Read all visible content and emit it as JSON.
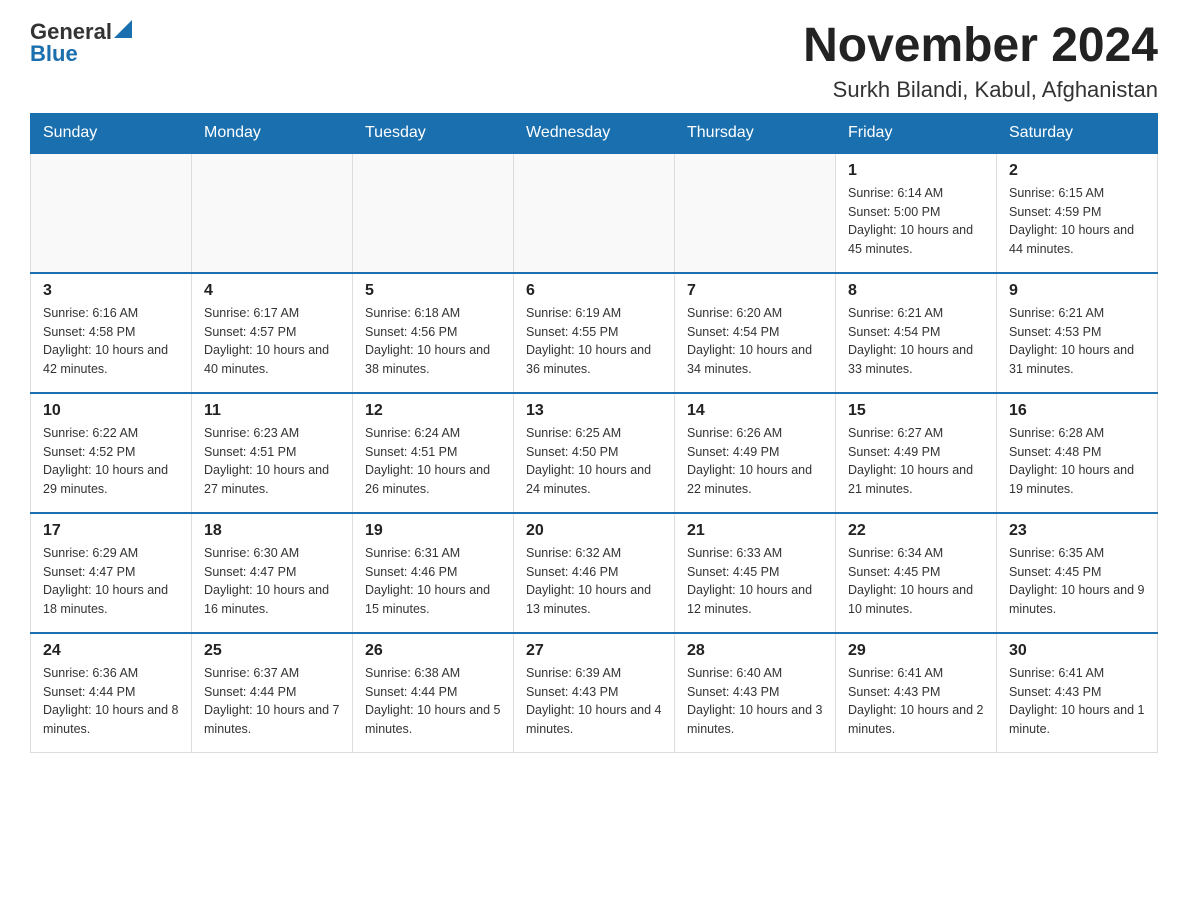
{
  "logo": {
    "general": "General",
    "blue": "Blue"
  },
  "title": "November 2024",
  "subtitle": "Surkh Bilandi, Kabul, Afghanistan",
  "days_of_week": [
    "Sunday",
    "Monday",
    "Tuesday",
    "Wednesday",
    "Thursday",
    "Friday",
    "Saturday"
  ],
  "weeks": [
    [
      {
        "day": "",
        "info": ""
      },
      {
        "day": "",
        "info": ""
      },
      {
        "day": "",
        "info": ""
      },
      {
        "day": "",
        "info": ""
      },
      {
        "day": "",
        "info": ""
      },
      {
        "day": "1",
        "info": "Sunrise: 6:14 AM\nSunset: 5:00 PM\nDaylight: 10 hours and 45 minutes."
      },
      {
        "day": "2",
        "info": "Sunrise: 6:15 AM\nSunset: 4:59 PM\nDaylight: 10 hours and 44 minutes."
      }
    ],
    [
      {
        "day": "3",
        "info": "Sunrise: 6:16 AM\nSunset: 4:58 PM\nDaylight: 10 hours and 42 minutes."
      },
      {
        "day": "4",
        "info": "Sunrise: 6:17 AM\nSunset: 4:57 PM\nDaylight: 10 hours and 40 minutes."
      },
      {
        "day": "5",
        "info": "Sunrise: 6:18 AM\nSunset: 4:56 PM\nDaylight: 10 hours and 38 minutes."
      },
      {
        "day": "6",
        "info": "Sunrise: 6:19 AM\nSunset: 4:55 PM\nDaylight: 10 hours and 36 minutes."
      },
      {
        "day": "7",
        "info": "Sunrise: 6:20 AM\nSunset: 4:54 PM\nDaylight: 10 hours and 34 minutes."
      },
      {
        "day": "8",
        "info": "Sunrise: 6:21 AM\nSunset: 4:54 PM\nDaylight: 10 hours and 33 minutes."
      },
      {
        "day": "9",
        "info": "Sunrise: 6:21 AM\nSunset: 4:53 PM\nDaylight: 10 hours and 31 minutes."
      }
    ],
    [
      {
        "day": "10",
        "info": "Sunrise: 6:22 AM\nSunset: 4:52 PM\nDaylight: 10 hours and 29 minutes."
      },
      {
        "day": "11",
        "info": "Sunrise: 6:23 AM\nSunset: 4:51 PM\nDaylight: 10 hours and 27 minutes."
      },
      {
        "day": "12",
        "info": "Sunrise: 6:24 AM\nSunset: 4:51 PM\nDaylight: 10 hours and 26 minutes."
      },
      {
        "day": "13",
        "info": "Sunrise: 6:25 AM\nSunset: 4:50 PM\nDaylight: 10 hours and 24 minutes."
      },
      {
        "day": "14",
        "info": "Sunrise: 6:26 AM\nSunset: 4:49 PM\nDaylight: 10 hours and 22 minutes."
      },
      {
        "day": "15",
        "info": "Sunrise: 6:27 AM\nSunset: 4:49 PM\nDaylight: 10 hours and 21 minutes."
      },
      {
        "day": "16",
        "info": "Sunrise: 6:28 AM\nSunset: 4:48 PM\nDaylight: 10 hours and 19 minutes."
      }
    ],
    [
      {
        "day": "17",
        "info": "Sunrise: 6:29 AM\nSunset: 4:47 PM\nDaylight: 10 hours and 18 minutes."
      },
      {
        "day": "18",
        "info": "Sunrise: 6:30 AM\nSunset: 4:47 PM\nDaylight: 10 hours and 16 minutes."
      },
      {
        "day": "19",
        "info": "Sunrise: 6:31 AM\nSunset: 4:46 PM\nDaylight: 10 hours and 15 minutes."
      },
      {
        "day": "20",
        "info": "Sunrise: 6:32 AM\nSunset: 4:46 PM\nDaylight: 10 hours and 13 minutes."
      },
      {
        "day": "21",
        "info": "Sunrise: 6:33 AM\nSunset: 4:45 PM\nDaylight: 10 hours and 12 minutes."
      },
      {
        "day": "22",
        "info": "Sunrise: 6:34 AM\nSunset: 4:45 PM\nDaylight: 10 hours and 10 minutes."
      },
      {
        "day": "23",
        "info": "Sunrise: 6:35 AM\nSunset: 4:45 PM\nDaylight: 10 hours and 9 minutes."
      }
    ],
    [
      {
        "day": "24",
        "info": "Sunrise: 6:36 AM\nSunset: 4:44 PM\nDaylight: 10 hours and 8 minutes."
      },
      {
        "day": "25",
        "info": "Sunrise: 6:37 AM\nSunset: 4:44 PM\nDaylight: 10 hours and 7 minutes."
      },
      {
        "day": "26",
        "info": "Sunrise: 6:38 AM\nSunset: 4:44 PM\nDaylight: 10 hours and 5 minutes."
      },
      {
        "day": "27",
        "info": "Sunrise: 6:39 AM\nSunset: 4:43 PM\nDaylight: 10 hours and 4 minutes."
      },
      {
        "day": "28",
        "info": "Sunrise: 6:40 AM\nSunset: 4:43 PM\nDaylight: 10 hours and 3 minutes."
      },
      {
        "day": "29",
        "info": "Sunrise: 6:41 AM\nSunset: 4:43 PM\nDaylight: 10 hours and 2 minutes."
      },
      {
        "day": "30",
        "info": "Sunrise: 6:41 AM\nSunset: 4:43 PM\nDaylight: 10 hours and 1 minute."
      }
    ]
  ]
}
